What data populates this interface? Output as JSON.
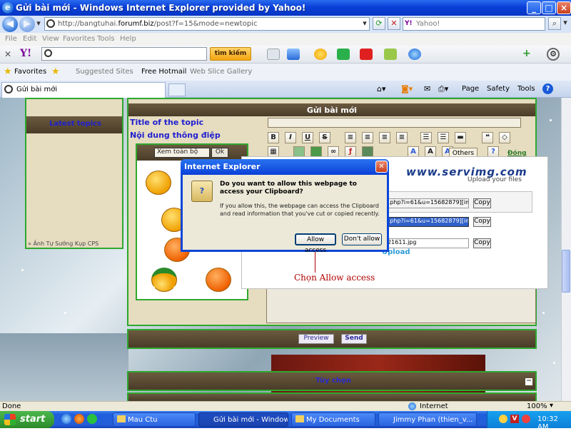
{
  "window": {
    "title": "Gửi bài mới - Windows Internet Explorer provided by Yahoo!"
  },
  "address": {
    "url_prefix": "http://bangtuhai.",
    "url_domain": "forumf.biz",
    "url_path": "/post?f=15&mode=newtopic",
    "search_placeholder": "Yahoo!"
  },
  "menu": [
    "File",
    "Edit",
    "View",
    "Favorites",
    "Tools",
    "Help"
  ],
  "yahoo": {
    "logo": "Y!",
    "search_button": "tìm kiếm"
  },
  "favorites": {
    "label": "Favorites",
    "items": [
      "Suggested Sites",
      "Free Hotmail",
      "Web Slice Gallery"
    ]
  },
  "tab": {
    "label": "Gửi bài mới"
  },
  "ietools": {
    "page": "Page",
    "safety": "Safety",
    "tools": "Tools"
  },
  "forum": {
    "sidebar_title": "Latest topics",
    "sidebar_link": "» Ảnh Tự Sướng Kụp CPS",
    "header": "Gửi bài mới",
    "title_label": "Title of the topic",
    "message_label": "Nội dung thông điệp",
    "smiley_select": "Xem toàn bộ",
    "smiley_ok": "Ok",
    "others": "Others",
    "close_link": "Đóng",
    "preview": "Preview",
    "send": "Send",
    "options": "Tùy chọn"
  },
  "servimg": {
    "logo": "www.servimg.com",
    "tagline": "Upload your files",
    "field1": "w.php?i=61&u=15682879][im",
    "field2": "w.php?i=61&u=15682879][im",
    "field3": "721611.jpg",
    "copy": "Copy",
    "upload": "Upload"
  },
  "dialog": {
    "title": "Internet Explorer",
    "question": "Do you want to allow this webpage to access your Clipboard?",
    "detail": "If you allow this, the webpage can access the Clipboard and read information that you've cut or copied recently.",
    "allow": "Allow access",
    "deny": "Don't allow"
  },
  "annotation": "Chọn Allow access",
  "status": {
    "left": "Done",
    "zone": "Internet",
    "zoom": "100%"
  },
  "taskbar": {
    "start": "start",
    "tasks": [
      "Mau Ctu",
      "Gửi bài mới - Window...",
      "My Documents",
      "Jimmy Phan (thien_v..."
    ],
    "clock": "10:32 AM"
  },
  "colors": {
    "accent": "#0a46d8",
    "forum_brown": "#5a4a32",
    "green_border": "#2ea82e",
    "annotation": "#b00000"
  }
}
